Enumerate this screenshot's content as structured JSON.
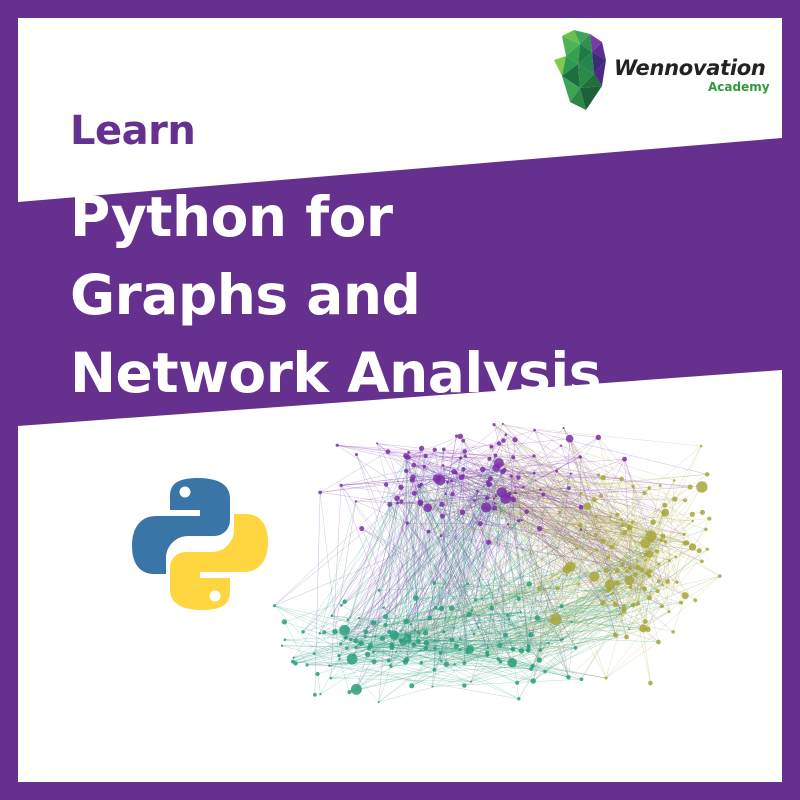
{
  "brand": {
    "name": "Wennovation",
    "sub": "Academy"
  },
  "heading": {
    "kicker": "Learn",
    "lines": [
      "Python for",
      "Graphs and",
      "Network Analysis"
    ]
  },
  "icons": {
    "brand_logo": "wennovation-logo-icon",
    "python_logo": "python-logo-icon",
    "network_graph": "network-graph-illustration"
  },
  "colors": {
    "frame": "#66308f",
    "band": "#66308f",
    "kicker": "#66308f",
    "headline": "#ffffff",
    "academy": "#2e9a3e",
    "python_blue": "#3a75a8",
    "python_yellow": "#ffd540",
    "network_purple": "#7a2fa8",
    "network_teal": "#2a9d7c",
    "network_olive": "#a8a63a"
  }
}
